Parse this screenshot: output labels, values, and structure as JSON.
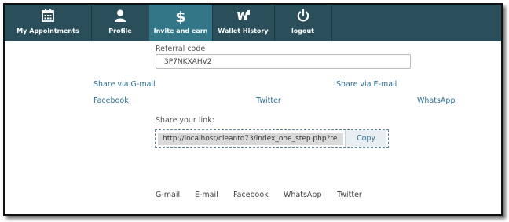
{
  "nav": {
    "items": [
      {
        "label": "My Appointments",
        "icon": "calendar-icon"
      },
      {
        "label": "Profile",
        "icon": "user-icon"
      },
      {
        "label": "Invite and earn",
        "icon": "dollar-icon"
      },
      {
        "label": "Wallet History",
        "icon": "wallet-icon"
      },
      {
        "label": "logout",
        "icon": "power-icon"
      }
    ],
    "active_index": 2
  },
  "referral": {
    "label": "Referral code",
    "code": "3P7NKXAHV2"
  },
  "share_links": {
    "gmail": "Share via G-mail",
    "email": "Share via E-mail",
    "facebook": "Facebook",
    "twitter": "Twitter",
    "whatsapp": "WhatsApp"
  },
  "share_your_link": {
    "label": "Share your link:",
    "url": "http://localhost/cleanto73/index_one_step.php?re",
    "copy_label": "Copy"
  },
  "bottom_links": [
    "G-mail",
    "E-mail",
    "Facebook",
    "WhatsApp",
    "Twitter"
  ],
  "colors": {
    "navbar": "#2a4f5a",
    "active_tab": "#327687",
    "link": "#2f6f8f"
  }
}
